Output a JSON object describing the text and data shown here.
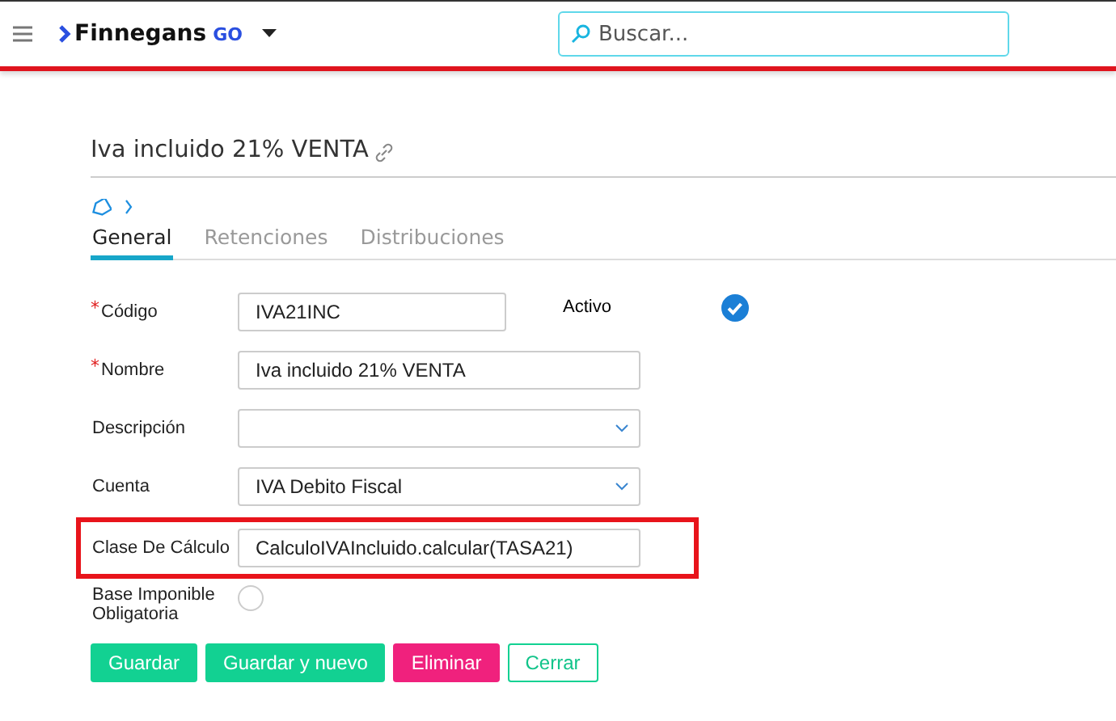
{
  "header": {
    "logo_text": "Finnegans",
    "logo_suffix": "GO",
    "search": {
      "placeholder": "Buscar..."
    }
  },
  "record": {
    "title": "Iva incluido 21% VENTA"
  },
  "tabs": [
    {
      "label": "General",
      "selected": true
    },
    {
      "label": "Retenciones",
      "selected": false
    },
    {
      "label": "Distribuciones",
      "selected": false
    }
  ],
  "form": {
    "required_mark": "*",
    "rows": [
      {
        "kind": "text",
        "label": "Código",
        "required": true,
        "value": "IVA21INC",
        "highlighted": false,
        "extra": {
          "label": "Activo",
          "checked": true
        }
      },
      {
        "kind": "text",
        "label": "Nombre",
        "required": true,
        "value": "Iva incluido 21% VENTA",
        "highlighted": false
      },
      {
        "kind": "select",
        "label": "Descripción",
        "required": false,
        "highlighted": false
      },
      {
        "kind": "select",
        "label": "Cuenta",
        "required": false,
        "value": "IVA Debito Fiscal",
        "highlighted": false
      },
      {
        "kind": "text",
        "label": "Clase De Cálculo",
        "required": false,
        "value": "CalculoIVAIncluido.calcular(TASA21)",
        "highlighted": true
      },
      {
        "kind": "toggle",
        "label": "Base Imponible Obligatoria",
        "required": false,
        "checked": false,
        "highlighted": false
      }
    ]
  },
  "buttons": [
    {
      "label": "Guardar",
      "kind": "primary"
    },
    {
      "label": "Guardar y nuevo",
      "kind": "primary"
    },
    {
      "label": "Eliminar",
      "kind": "danger"
    },
    {
      "label": "Cerrar",
      "kind": "outline"
    }
  ]
}
